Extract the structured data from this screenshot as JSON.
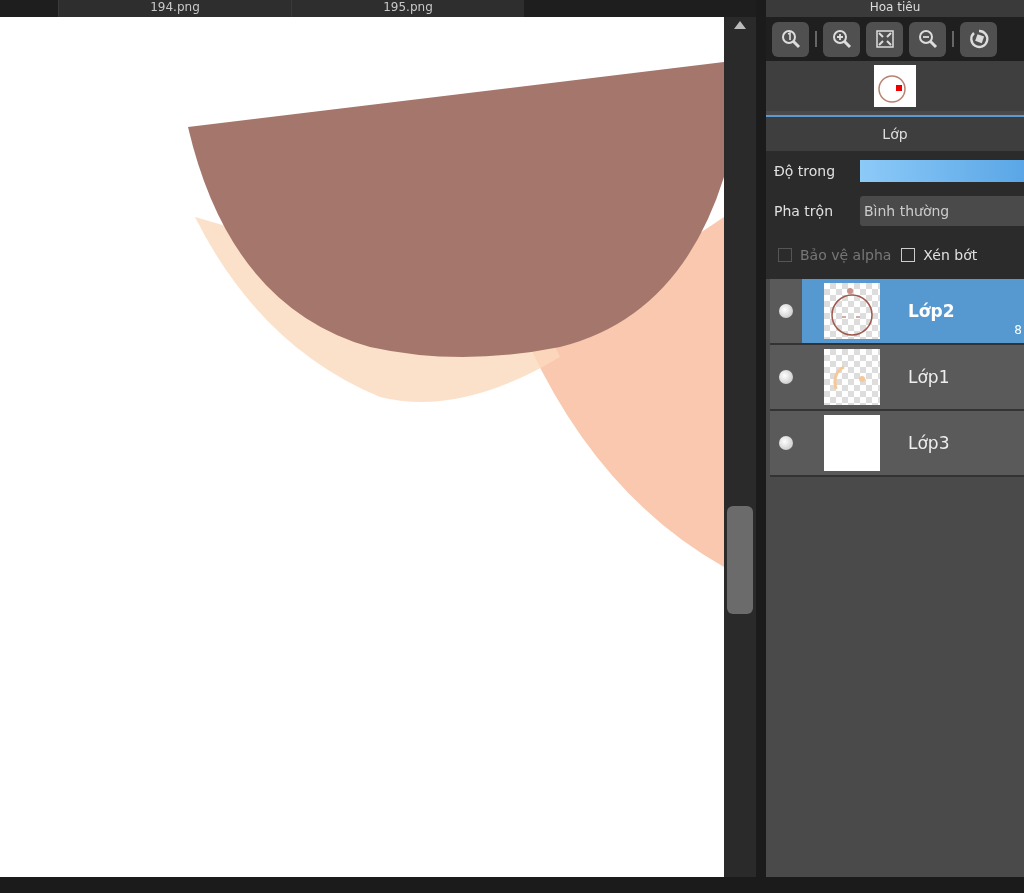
{
  "tabs": [
    {
      "label": "194.png",
      "selected": false
    },
    {
      "label": "195.png",
      "selected": false
    }
  ],
  "navigator": {
    "title": "Hoa tiêu"
  },
  "layers_panel": {
    "title": "Lớp",
    "opacity": {
      "label": "Độ trong",
      "level": 1
    },
    "blend": {
      "label": "Pha trộn",
      "value": "Bình thường"
    },
    "options": [
      {
        "label": "Bảo vệ alpha",
        "checked": false,
        "disabled": true
      },
      {
        "label": "Xén bớt",
        "checked": false,
        "disabled": false
      }
    ],
    "layers": [
      {
        "name": "Lớp2",
        "selected": true,
        "visible": true,
        "kind": "sketch",
        "opacity": "8"
      },
      {
        "name": "Lớp1",
        "selected": false,
        "visible": true,
        "kind": "color"
      },
      {
        "name": "Lớp3",
        "selected": false,
        "visible": true,
        "kind": "white"
      }
    ]
  }
}
